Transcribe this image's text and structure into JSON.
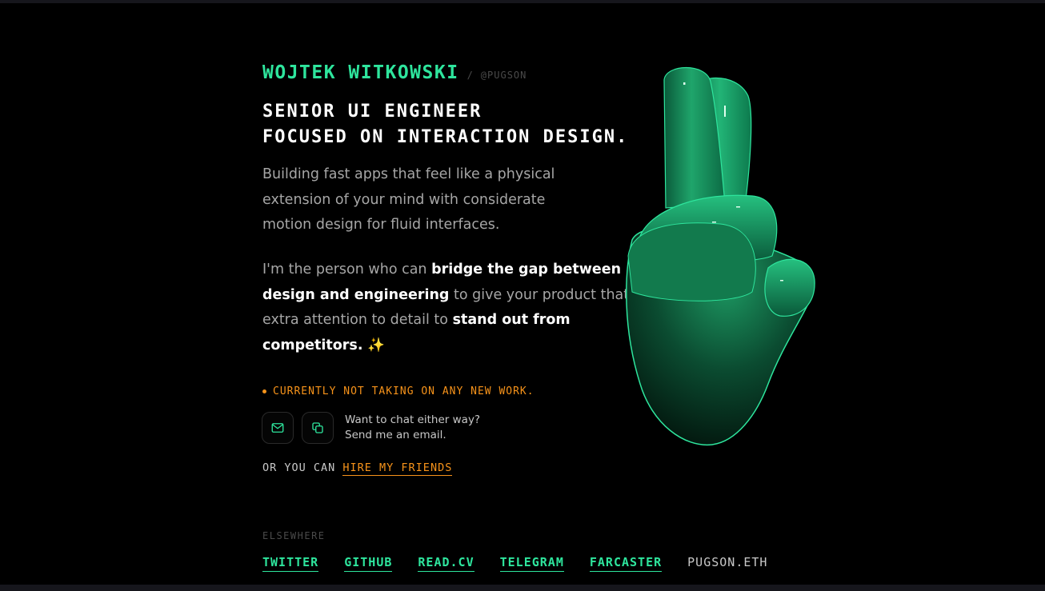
{
  "header": {
    "name": "WOJTEK WITKOWSKI",
    "separator": "/",
    "handle": "@PUGSON"
  },
  "tagline": {
    "line1": "SENIOR UI ENGINEER",
    "line2": "FOCUSED ON INTERACTION DESIGN."
  },
  "intro": {
    "line1": "Building fast apps that feel like a physical",
    "line2": "extension of your mind with considerate",
    "line3": "motion design for fluid interfaces."
  },
  "pitch": {
    "part1": "I'm the person who can ",
    "highlight1": "bridge the gap between design and engineering",
    "part2": " to give your product that extra attention to detail to ",
    "highlight2": "stand out from competitors.",
    "emoji": " ✨"
  },
  "status": {
    "text": "CURRENTLY NOT TAKING ON ANY NEW WORK."
  },
  "contact": {
    "line1": "Want to chat either way?",
    "line2": "Send me an email.",
    "email_icon": "mail-icon",
    "copy_icon": "copy-icon"
  },
  "friends": {
    "prefix": "OR YOU CAN ",
    "link": "HIRE MY FRIENDS"
  },
  "elsewhere": {
    "label": "ELSEWHERE",
    "links": [
      "TWITTER",
      "GITHUB",
      "READ.CV",
      "TELEGRAM",
      "FARCASTER"
    ],
    "eth": "PUGSON.ETH"
  },
  "colors": {
    "accent_green": "#2ee59d",
    "accent_orange": "#f7931a",
    "background": "#000000"
  }
}
